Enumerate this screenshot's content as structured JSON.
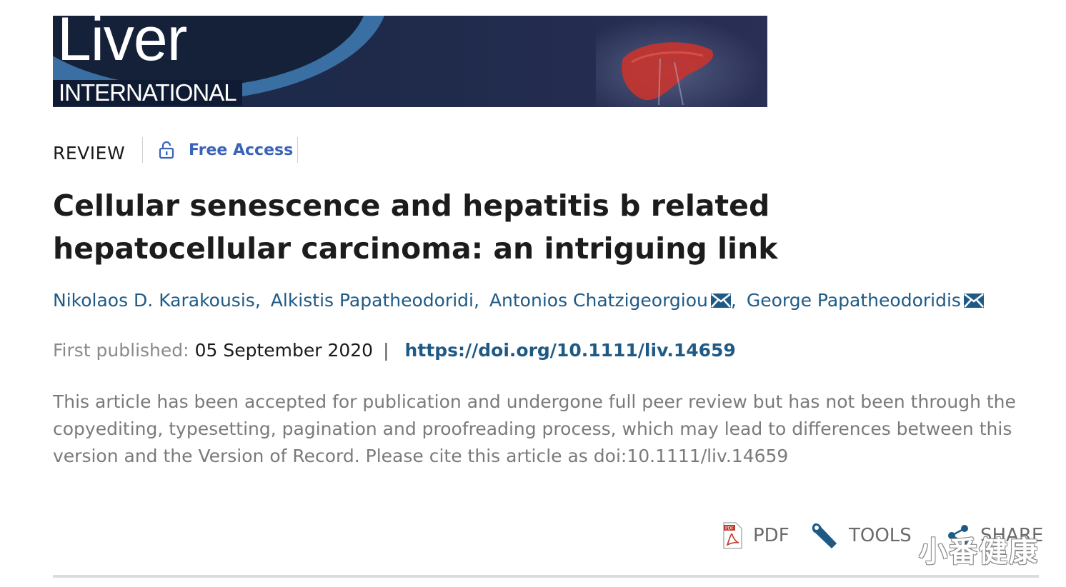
{
  "banner": {
    "logo_main": "Liver",
    "logo_sub": "INTERNATIONAL"
  },
  "article": {
    "type_label": "REVIEW",
    "access_label": "Free Access",
    "title": "Cellular senescence and hepatitis b related hepatocellular carcinoma: an intriguing link",
    "authors": [
      {
        "name": "Nikolaos D. Karakousis",
        "has_mail": false
      },
      {
        "name": "Alkistis Papatheodoridi",
        "has_mail": false
      },
      {
        "name": "Antonios Chatzigeorgiou",
        "has_mail": true
      },
      {
        "name": "George Papatheodoridis",
        "has_mail": true
      }
    ],
    "published_label": "First published:",
    "published_date": "05 September 2020",
    "separator": "|",
    "doi_link": "https://doi.org/10.1111/liv.14659",
    "notice": "This article has been accepted for publication and undergone full peer review but has not been through the copyediting, typesetting, pagination and proofreading process, which may lead to differences between this version and the Version of Record. Please cite this article as doi:10.1111/liv.14659"
  },
  "toolbar": {
    "pdf_label": "PDF",
    "tools_label": "TOOLS",
    "share_label": "SHARE"
  },
  "watermark": "小番健康",
  "colors": {
    "link": "#1f5a85",
    "access": "#3a63b8",
    "muted": "#7a7a7a",
    "banner": "#1b2846"
  }
}
